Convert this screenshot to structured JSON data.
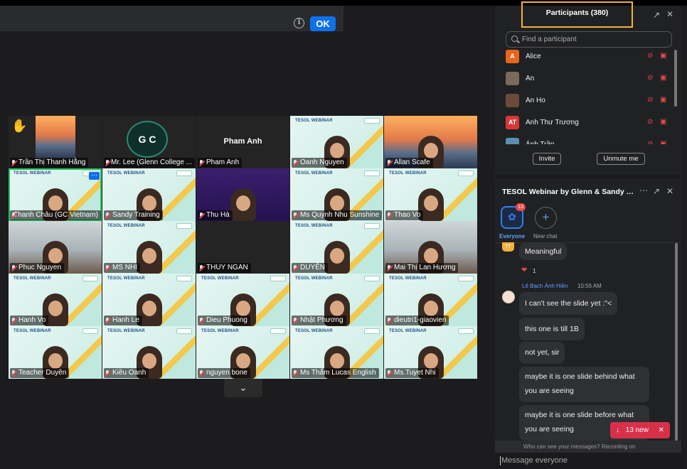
{
  "notice_bar": {
    "info_icon": "info-icon",
    "ok_label": "OK"
  },
  "video_tiles": [
    {
      "name": "Trần Thị Thanh Hằng",
      "style": "bridge-hand"
    },
    {
      "name": "Mr. Lee (Glenn College ...",
      "style": "logo"
    },
    {
      "name": "Pham Anh",
      "style": "avatar",
      "center_name": "Pham Anh"
    },
    {
      "name": "Oanh Nguyen",
      "style": "webinar"
    },
    {
      "name": "Allan Scafe",
      "style": "bridge"
    },
    {
      "name": "Thanh Châu (GC Vietnam)",
      "style": "webinar-highlight"
    },
    {
      "name": "Sandy Training",
      "style": "webinar"
    },
    {
      "name": "Thu Hà",
      "style": "purple"
    },
    {
      "name": "Ms Quynh Nhu Sunshine",
      "style": "webinar"
    },
    {
      "name": "Thao Vo",
      "style": "webinar"
    },
    {
      "name": "Phuc Nguyen",
      "style": "room"
    },
    {
      "name": "MS NHI",
      "style": "webinar"
    },
    {
      "name": "THUY NGAN",
      "style": "dark"
    },
    {
      "name": "DUYÊN",
      "style": "webinar"
    },
    {
      "name": "Mai Thị Lan Hương",
      "style": "room"
    },
    {
      "name": "Hanh Vo",
      "style": "webinar"
    },
    {
      "name": "Hanh Le",
      "style": "webinar"
    },
    {
      "name": "Dieu Phuong",
      "style": "webinar"
    },
    {
      "name": "Nhật Phương",
      "style": "webinar"
    },
    {
      "name": "dieutri1-giaovien",
      "style": "webinar"
    },
    {
      "name": "Teacher Duyên",
      "style": "webinar"
    },
    {
      "name": "Kiều Oanh",
      "style": "webinar"
    },
    {
      "name": "nguyen bone",
      "style": "webinar"
    },
    {
      "name": "Ms Thắm Lucas English",
      "style": "webinar"
    },
    {
      "name": "Ms.Tuyet Nhi",
      "style": "webinar"
    }
  ],
  "webinar_label": "TESOL WEBINAR",
  "webinar_label_mirrored": "TESOL WEBINAR",
  "gc_logo_text": "G C",
  "participants": {
    "title": "Participants (380)",
    "search_placeholder": "Find a participant",
    "list": [
      {
        "initials": "A",
        "name": "Alice",
        "color": "#e8651b"
      },
      {
        "initials": "",
        "name": "An",
        "color": "#7a6a5a"
      },
      {
        "initials": "",
        "name": "An Ho",
        "color": "#6b4a3a"
      },
      {
        "initials": "AT",
        "name": "Anh Thư Trương",
        "color": "#d93737"
      },
      {
        "initials": "",
        "name": "Ánh Trần",
        "color": "#5b8fb0"
      }
    ],
    "invite_label": "Invite",
    "unmute_label": "Unmute me"
  },
  "chat": {
    "title": "TESOL Webinar by Glenn & Sandy Trai...",
    "everyone_label": "Everyone",
    "everyone_badge": "13",
    "new_chat_label": "New chat",
    "tt_initials": "TT",
    "reaction_count": "1",
    "sender_name": "Lê Bạch Ánh Hiền",
    "sender_time": "10:56 AM",
    "messages": [
      {
        "line1": "Meaningful",
        "line2": ""
      },
      {
        "line1": "I can't see the slide yet :\"<",
        "line2": ""
      },
      {
        "line1": "this one is till 1B",
        "line2": ""
      },
      {
        "line1": "not yet, sir",
        "line2": ""
      },
      {
        "line1": "maybe it is one slide behind what",
        "line2": "you are seeing"
      },
      {
        "line1": "maybe it is one slide before what",
        "line2": "you are seeing"
      }
    ],
    "new_messages_label": "13 new",
    "visibility_notice": "Who can see your messages? Recording on",
    "input_placeholder": "Message everyone"
  }
}
